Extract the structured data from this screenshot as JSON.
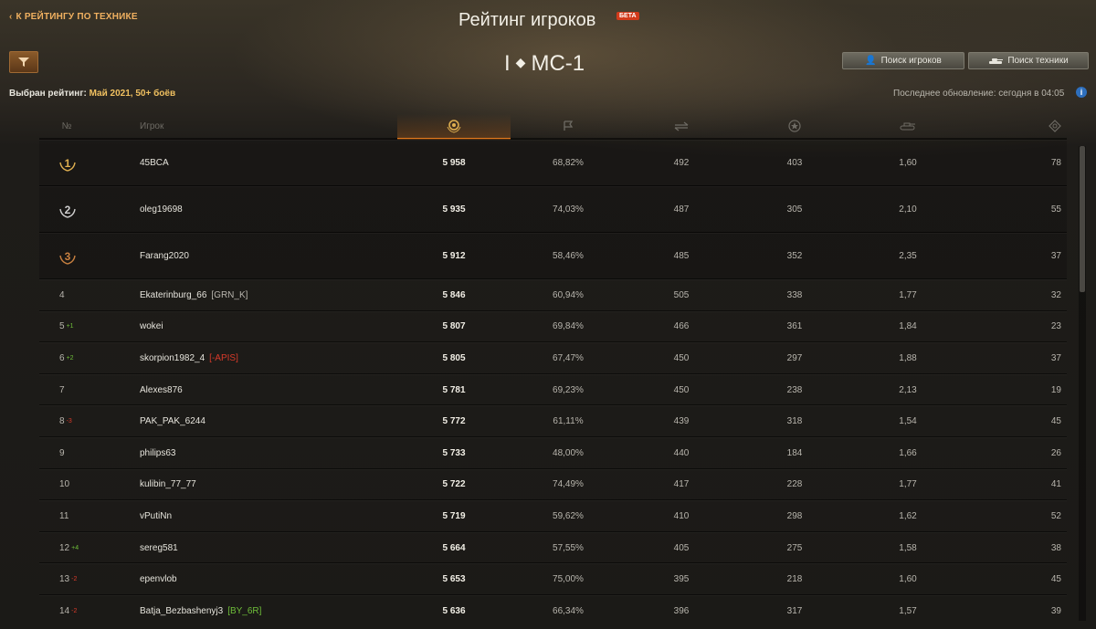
{
  "header": {
    "back_link": "К РЕЙТИНГУ ПО ТЕХНИКЕ",
    "title": "Рейтинг игроков",
    "beta": "БЕТА",
    "tank_tier": "I",
    "tank_name": "МС-1",
    "search_players": "Поиск игроков",
    "search_tech": "Поиск техники",
    "rating_label": "Выбран рейтинг:",
    "rating_value": "Май 2021, 50+ боёв",
    "last_update": "Последнее обновление: сегодня в 04:05"
  },
  "colors": {
    "accent": "#f0b060",
    "sort_highlight": "#e07a20",
    "gain": "#6fbf3a",
    "loss": "#d83a2a",
    "gold": "#e0b050",
    "silver": "#d0d0d0",
    "bronze": "#c88040"
  },
  "columns": {
    "pos": "№",
    "player": "Игрок",
    "icons": [
      "rating-medal-icon",
      "flag-icon",
      "battles-icon",
      "star-icon",
      "tank-icon",
      "spot-icon"
    ]
  },
  "rows": [
    {
      "pos": "1",
      "delta": "",
      "player": "45BCA",
      "clan": "",
      "clan_color": "",
      "rating": "5 958",
      "winrate": "68,82%",
      "c2": "492",
      "c3": "403",
      "c4": "1,60",
      "c5": "78",
      "medal": "gold"
    },
    {
      "pos": "2",
      "delta": "",
      "player": "oleg19698",
      "clan": "",
      "clan_color": "",
      "rating": "5 935",
      "winrate": "74,03%",
      "c2": "487",
      "c3": "305",
      "c4": "2,10",
      "c5": "55",
      "medal": "silver"
    },
    {
      "pos": "3",
      "delta": "",
      "player": "Farang2020",
      "clan": "",
      "clan_color": "",
      "rating": "5 912",
      "winrate": "58,46%",
      "c2": "485",
      "c3": "352",
      "c4": "2,35",
      "c5": "37",
      "medal": "bronze"
    },
    {
      "pos": "4",
      "delta": "",
      "player": "Ekaterinburg_66",
      "clan": "[GRN_K]",
      "clan_color": "#b8b5ad",
      "rating": "5 846",
      "winrate": "60,94%",
      "c2": "505",
      "c3": "338",
      "c4": "1,77",
      "c5": "32",
      "medal": ""
    },
    {
      "pos": "5",
      "delta": "+1",
      "player": "wokei",
      "clan": "",
      "clan_color": "",
      "rating": "5 807",
      "winrate": "69,84%",
      "c2": "466",
      "c3": "361",
      "c4": "1,84",
      "c5": "23",
      "medal": ""
    },
    {
      "pos": "6",
      "delta": "+2",
      "player": "skorpion1982_4",
      "clan": "[-APIS]",
      "clan_color": "#d83a2a",
      "rating": "5 805",
      "winrate": "67,47%",
      "c2": "450",
      "c3": "297",
      "c4": "1,88",
      "c5": "37",
      "medal": ""
    },
    {
      "pos": "7",
      "delta": "",
      "player": "Alexes876",
      "clan": "",
      "clan_color": "",
      "rating": "5 781",
      "winrate": "69,23%",
      "c2": "450",
      "c3": "238",
      "c4": "2,13",
      "c5": "19",
      "medal": ""
    },
    {
      "pos": "8",
      "delta": "-3",
      "player": "PAK_PAK_6244",
      "clan": "",
      "clan_color": "",
      "rating": "5 772",
      "winrate": "61,11%",
      "c2": "439",
      "c3": "318",
      "c4": "1,54",
      "c5": "45",
      "medal": ""
    },
    {
      "pos": "9",
      "delta": "",
      "player": "philips63",
      "clan": "",
      "clan_color": "",
      "rating": "5 733",
      "winrate": "48,00%",
      "c2": "440",
      "c3": "184",
      "c4": "1,66",
      "c5": "26",
      "medal": ""
    },
    {
      "pos": "10",
      "delta": "",
      "player": "kulibin_77_77",
      "clan": "",
      "clan_color": "",
      "rating": "5 722",
      "winrate": "74,49%",
      "c2": "417",
      "c3": "228",
      "c4": "1,77",
      "c5": "41",
      "medal": ""
    },
    {
      "pos": "11",
      "delta": "",
      "player": "vPutiNn",
      "clan": "",
      "clan_color": "",
      "rating": "5 719",
      "winrate": "59,62%",
      "c2": "410",
      "c3": "298",
      "c4": "1,62",
      "c5": "52",
      "medal": ""
    },
    {
      "pos": "12",
      "delta": "+4",
      "player": "sereg581",
      "clan": "",
      "clan_color": "",
      "rating": "5 664",
      "winrate": "57,55%",
      "c2": "405",
      "c3": "275",
      "c4": "1,58",
      "c5": "38",
      "medal": ""
    },
    {
      "pos": "13",
      "delta": "-2",
      "player": "epenvlob",
      "clan": "",
      "clan_color": "",
      "rating": "5 653",
      "winrate": "75,00%",
      "c2": "395",
      "c3": "218",
      "c4": "1,60",
      "c5": "45",
      "medal": ""
    },
    {
      "pos": "14",
      "delta": "-2",
      "player": "Batja_Bezbashenyj3",
      "clan": "[BY_6R]",
      "clan_color": "#6fbf3a",
      "rating": "5 636",
      "winrate": "66,34%",
      "c2": "396",
      "c3": "317",
      "c4": "1,57",
      "c5": "39",
      "medal": ""
    }
  ]
}
